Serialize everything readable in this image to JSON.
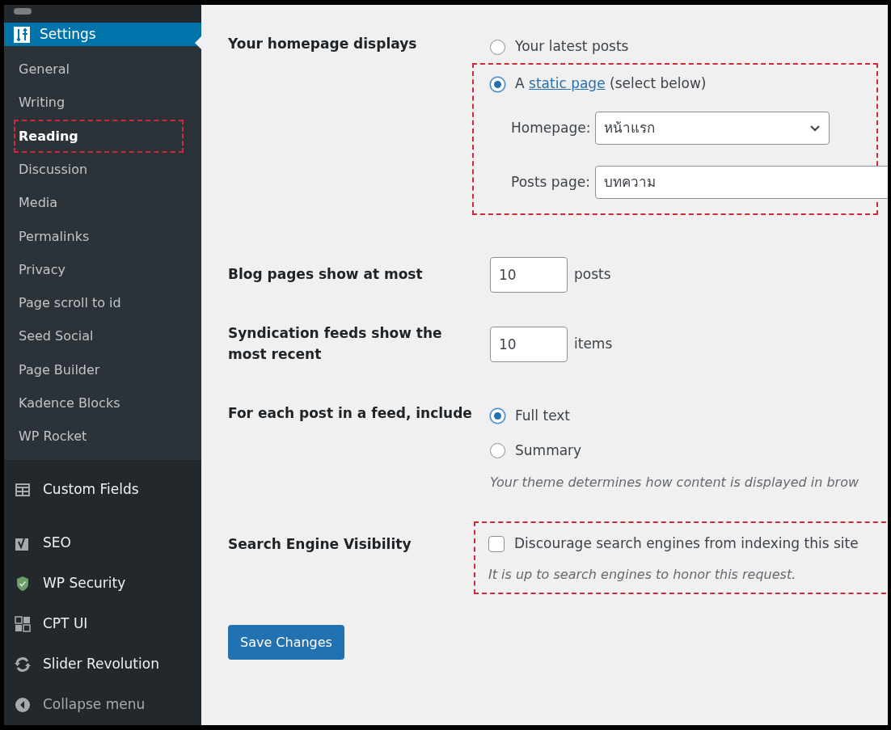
{
  "sidebar": {
    "current": {
      "label": "Settings",
      "selected": true
    },
    "submenu": [
      {
        "label": "General",
        "selected": false,
        "highlighted": false
      },
      {
        "label": "Writing",
        "selected": false,
        "highlighted": false
      },
      {
        "label": "Reading",
        "selected": true,
        "highlighted": true
      },
      {
        "label": "Discussion",
        "selected": false,
        "highlighted": false
      },
      {
        "label": "Media",
        "selected": false,
        "highlighted": false
      },
      {
        "label": "Permalinks",
        "selected": false,
        "highlighted": false
      },
      {
        "label": "Privacy",
        "selected": false,
        "highlighted": false
      },
      {
        "label": "Page scroll to id",
        "selected": false,
        "highlighted": false
      },
      {
        "label": "Seed Social",
        "selected": false,
        "highlighted": false
      },
      {
        "label": "Page Builder",
        "selected": false,
        "highlighted": false
      },
      {
        "label": "Kadence Blocks",
        "selected": false,
        "highlighted": false
      },
      {
        "label": "WP Rocket",
        "selected": false,
        "highlighted": false
      }
    ],
    "menu": [
      {
        "label": "Custom Fields",
        "kind": "fields"
      },
      {
        "label": "SEO",
        "kind": "seo"
      },
      {
        "label": "WP Security",
        "kind": "shield"
      },
      {
        "label": "CPT UI",
        "kind": "grid"
      },
      {
        "label": "Slider Revolution",
        "kind": "refresh"
      },
      {
        "label": "Collapse menu",
        "kind": "collapse"
      }
    ]
  },
  "homepage_displays": {
    "label": "Your homepage displays",
    "highlighted": true,
    "options": [
      {
        "text": "Your latest posts",
        "selected": false
      },
      {
        "text": "A ",
        "link": "static page",
        "rest": " (select below)",
        "selected": true
      }
    ],
    "homepage": {
      "label": "Homepage:",
      "value": "หน้าแรก"
    },
    "posts_page": {
      "label": "Posts page:",
      "value": "บทความ"
    }
  },
  "blog_pages": {
    "label": "Blog pages show at most",
    "value": "10",
    "unit": "posts"
  },
  "syndication": {
    "label": "Syndication feeds show the most recent",
    "value": "10",
    "unit": "items"
  },
  "feed_include": {
    "label": "For each post in a feed, include",
    "options": [
      {
        "text": "Full text",
        "selected": true
      },
      {
        "text": "Summary",
        "selected": false
      }
    ],
    "note": "Your theme determines how content is displayed in brow"
  },
  "search_visibility": {
    "label": "Search Engine Visibility",
    "highlighted": true,
    "checkbox": {
      "text": "Discourage search engines from indexing this site",
      "checked": false
    },
    "note": "It is up to search engines to honor this request."
  },
  "save_button": "Save Changes"
}
